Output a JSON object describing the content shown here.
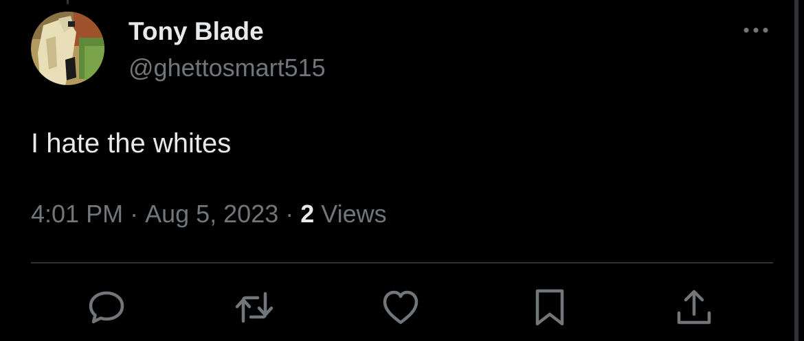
{
  "tweet": {
    "display_name": "Tony Blade",
    "handle": "@ghettosmart515",
    "text": "I hate the whites",
    "time": "4:01 PM",
    "date": "Aug 5, 2023",
    "views_count": "2",
    "views_label": "Views"
  },
  "icons": {
    "more": "more-horizontal-icon",
    "reply": "reply-icon",
    "retweet": "retweet-icon",
    "like": "heart-icon",
    "bookmark": "bookmark-icon",
    "share": "share-icon"
  },
  "colors": {
    "background": "#000000",
    "primary_text": "#e7e9ea",
    "secondary_text": "#71767b",
    "divider": "#2f3336"
  }
}
